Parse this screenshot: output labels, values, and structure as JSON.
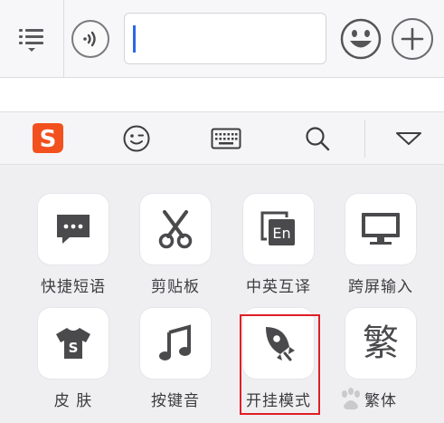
{
  "chat_input": {
    "value": "",
    "placeholder": ""
  },
  "toolbar": {
    "items": [
      {
        "name": "sogou-logo-icon"
      },
      {
        "name": "emoji-face-icon"
      },
      {
        "name": "keyboard-icon"
      },
      {
        "name": "search-icon"
      },
      {
        "name": "collapse-triangle-icon"
      }
    ]
  },
  "functions": [
    {
      "label": "快捷短语",
      "icon": "chat-bubble-icon"
    },
    {
      "label": "剪贴板",
      "icon": "scissors-icon"
    },
    {
      "label": "中英互译",
      "icon": "translate-icon"
    },
    {
      "label": "跨屏输入",
      "icon": "monitor-icon"
    },
    {
      "label": "皮 肤",
      "icon": "tshirt-icon"
    },
    {
      "label": "按键音",
      "icon": "music-note-icon"
    },
    {
      "label": "开挂模式",
      "icon": "rocket-icon"
    },
    {
      "label": "繁体",
      "icon": "traditional-char-icon",
      "glyph": "繁"
    }
  ],
  "translate_glyph": "En",
  "logo_glyph": "S",
  "tshirt_glyph": "S",
  "colors": {
    "accent": "#f2501e",
    "icon_gray": "#4a4a4d",
    "highlight": "#e01e25",
    "caret": "#2a66e8"
  }
}
